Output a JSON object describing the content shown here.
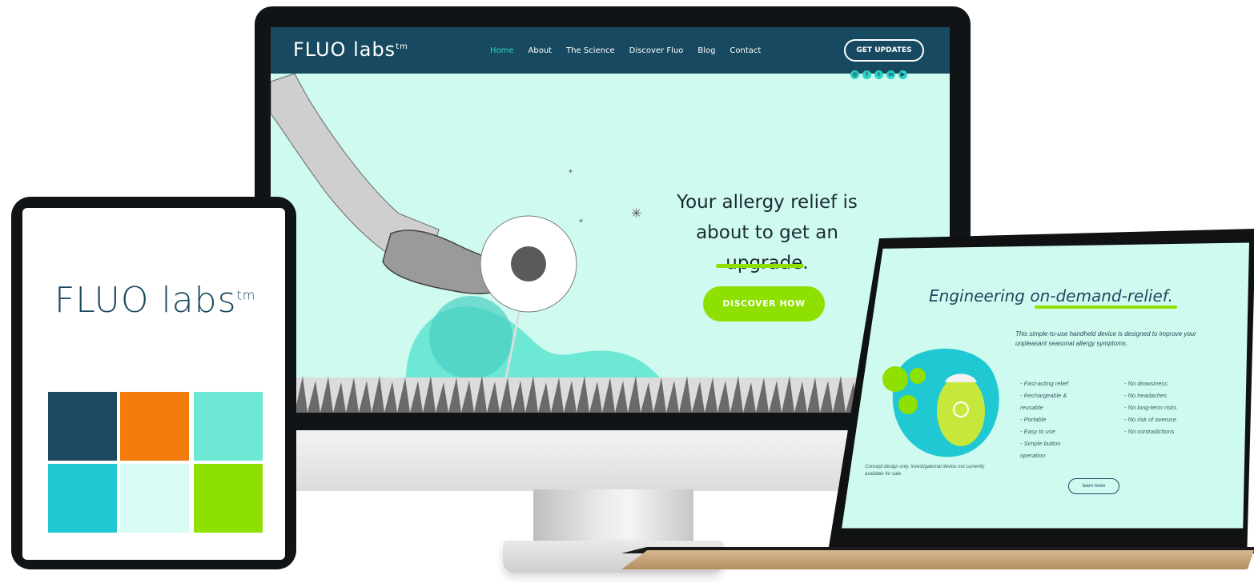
{
  "desktop": {
    "logo": "FLUO labs",
    "logo_tm": "tm",
    "nav": [
      {
        "label": "Home",
        "active": true
      },
      {
        "label": "About",
        "active": false
      },
      {
        "label": "The Science",
        "active": false
      },
      {
        "label": "Discover Fluo",
        "active": false
      },
      {
        "label": "Blog",
        "active": false
      },
      {
        "label": "Contact",
        "active": false
      }
    ],
    "cta": "GET UPDATES",
    "social": [
      "instagram-icon",
      "facebook-icon",
      "twitter-icon",
      "linkedin-icon",
      "youtube-icon"
    ],
    "hero_line1": "Your allergy relief is",
    "hero_line2": "about to get an",
    "hero_line3": "upgrade.",
    "button": "DISCOVER HOW",
    "colors": {
      "nav": "#174a60",
      "hero_bg": "#cffaef",
      "accent": "#8ee000",
      "teal": "#2bd3c5"
    }
  },
  "tablet": {
    "logo": "FLUO labs",
    "logo_tm": "tm",
    "swatches": [
      "#1c4960",
      "#f37c0c",
      "#6de8d4",
      "#1fc8d2",
      "#d8fbf4",
      "#8ee000"
    ]
  },
  "laptop": {
    "title": "Engineering on-demand-relief.",
    "intro": "This simple-to-use handheld device is designed to improve your unpleasant seasonal allergy symptoms.",
    "features_left": [
      "- Fast-acting relief",
      "- Rechargeable &",
      "  reusable",
      "- Portable",
      "- Easy to use",
      "- Simple button",
      "  operation"
    ],
    "features_right": [
      "- No drowsiness",
      "- No headaches",
      "- No long-term risks",
      "- No risk of overuse",
      "- No contradictions"
    ],
    "note": "Concept design only. Investigational device not currently available for sale.",
    "button": "learn more"
  }
}
